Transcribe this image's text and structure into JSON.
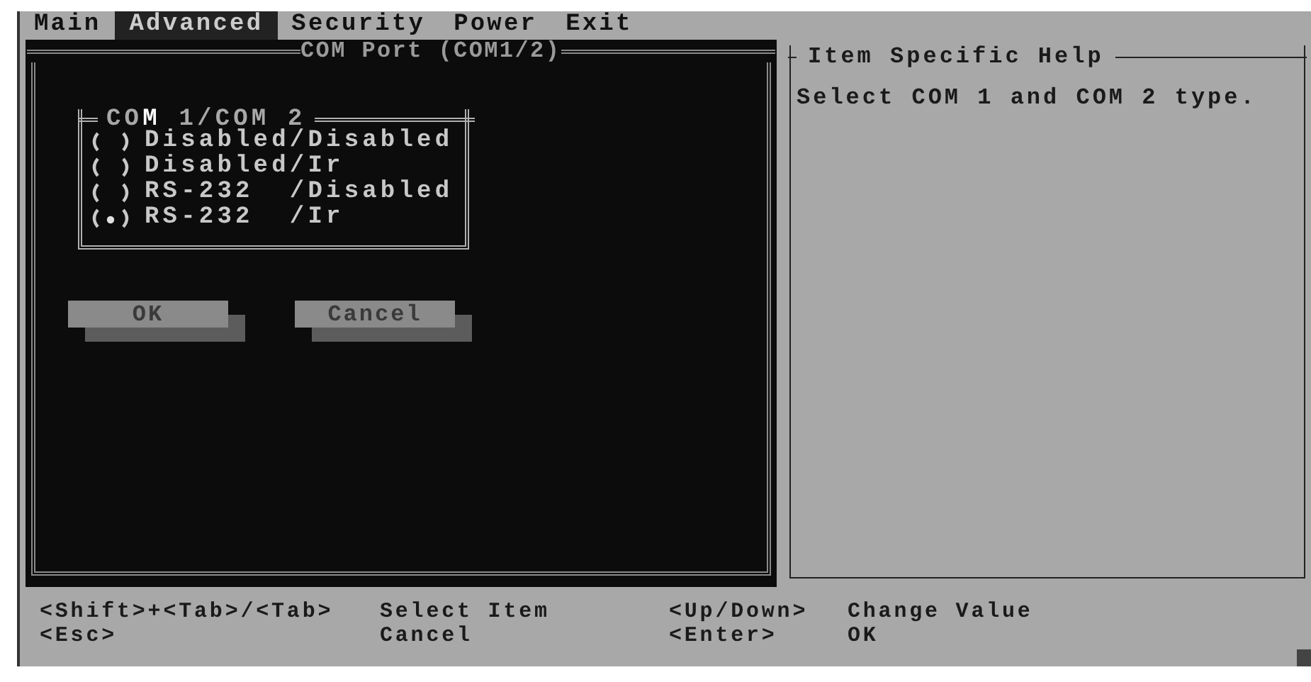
{
  "menu": [
    {
      "label": "Main",
      "selected": false
    },
    {
      "label": "Advanced",
      "selected": true
    },
    {
      "label": "Security",
      "selected": false
    },
    {
      "label": "Power",
      "selected": false
    },
    {
      "label": "Exit",
      "selected": false
    }
  ],
  "dialog": {
    "title": "COM Port (COM1/2)",
    "group": {
      "title": "CO**M** 1/COM 2",
      "options": [
        {
          "label": "Disabled/Disabled",
          "selected": false
        },
        {
          "label": "Disabled/Ir",
          "selected": false
        },
        {
          "label": "RS-232  /Disabled",
          "selected": false
        },
        {
          "label": "RS-232  /Ir",
          "selected": true
        }
      ]
    },
    "buttons": [
      "OK",
      "Cancel"
    ]
  },
  "help": {
    "title": "Item Specific Help",
    "text": "Select COM 1 and COM 2 type."
  },
  "keys": [
    {
      "key": "<Shift>+<Tab>/<Tab>",
      "action": "Select Item"
    },
    {
      "key": "<Up/Down>",
      "action": "Change Value"
    },
    {
      "key": "<Esc>",
      "action": "Cancel"
    },
    {
      "key": "<Enter>",
      "action": "OK"
    }
  ]
}
